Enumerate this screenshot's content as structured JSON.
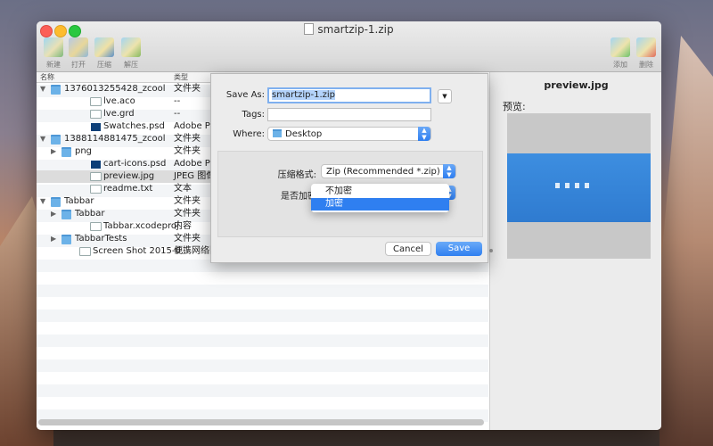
{
  "window": {
    "title": "smartzip-1.zip"
  },
  "toolbar": {
    "new_label": "新建",
    "open_label": "打开",
    "compress_label": "压缩",
    "extract_label": "解压",
    "add_label": "添加",
    "delete_label": "删除"
  },
  "columns": {
    "name": "名称",
    "type": "类型"
  },
  "files": [
    {
      "name": "1376013255428_zcool",
      "type": "文件夹",
      "kind": "folder",
      "indent": 0,
      "expanded": true
    },
    {
      "name": "lve.aco",
      "type": "--",
      "kind": "file",
      "indent": 2
    },
    {
      "name": "lve.grd",
      "type": "--",
      "kind": "file",
      "indent": 2
    },
    {
      "name": "Swatches.psd",
      "type": "Adobe Pl",
      "kind": "psd",
      "indent": 2
    },
    {
      "name": "1388114881475_zcool",
      "type": "文件夹",
      "kind": "folder",
      "indent": 0,
      "expanded": true
    },
    {
      "name": "png",
      "type": "文件夹",
      "kind": "folder",
      "indent": 1,
      "expanded": false
    },
    {
      "name": "cart-icons.psd",
      "type": "Adobe Pl",
      "kind": "psd",
      "indent": 2
    },
    {
      "name": "preview.jpg",
      "type": "JPEG 图像",
      "kind": "file",
      "indent": 2,
      "selected": true
    },
    {
      "name": "readme.txt",
      "type": "文本",
      "kind": "file",
      "indent": 2
    },
    {
      "name": "Tabbar",
      "type": "文件夹",
      "kind": "folder",
      "indent": 0,
      "expanded": true
    },
    {
      "name": "Tabbar",
      "type": "文件夹",
      "kind": "folder",
      "indent": 1,
      "expanded": false
    },
    {
      "name": "Tabbar.xcodeproj",
      "type": "内容",
      "kind": "file",
      "indent": 2
    },
    {
      "name": "TabbarTests",
      "type": "文件夹",
      "kind": "folder",
      "indent": 1,
      "expanded": false
    },
    {
      "name": "Screen Shot 2015-0...",
      "type": "便携网络图",
      "kind": "file",
      "indent": 1
    }
  ],
  "preview": {
    "title": "preview.jpg",
    "label": "预览:"
  },
  "save_dialog": {
    "save_as_label": "Save As:",
    "filename": "smartzip-1.zip",
    "tags_label": "Tags:",
    "where_label": "Where:",
    "where_value": "Desktop",
    "format_label": "压缩格式:",
    "format_value": "Zip (Recommended *.zip)",
    "encrypt_label": "是否加密",
    "encrypt_options": [
      "不加密",
      "加密"
    ],
    "cancel_label": "Cancel",
    "save_label": "Save"
  },
  "colors": {
    "accent": "#2f7ff0",
    "selection": "#3a8cf0",
    "folder": "#6cb2e8"
  }
}
